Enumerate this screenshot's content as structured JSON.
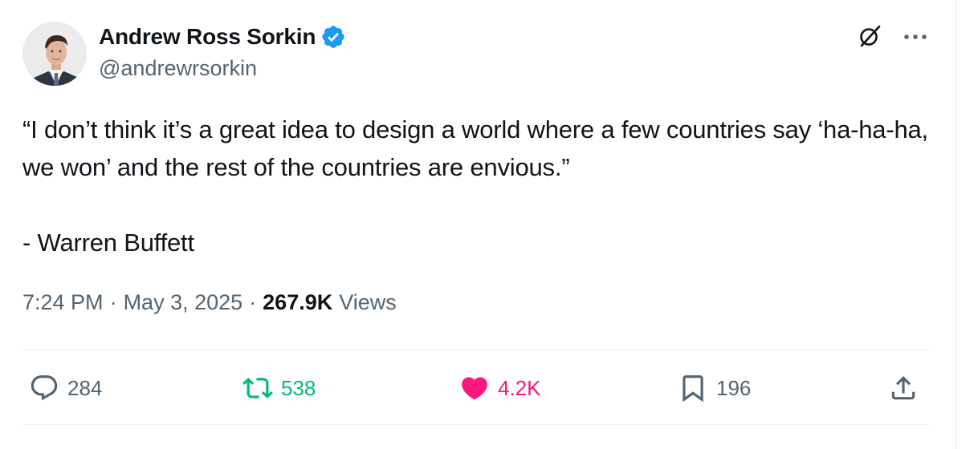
{
  "author": {
    "name": "Andrew Ross Sorkin",
    "handle": "@andrewrsorkin",
    "verified": true
  },
  "tweet": {
    "text": "“I don’t think it’s a great idea to design a world where a few countries say ‘ha-ha-ha, we won’ and the rest of the countries are envious.”\n\n- Warren Buffett"
  },
  "meta": {
    "time": "7:24 PM",
    "separator": "·",
    "date": "May 3, 2025",
    "views_count": "267.9K",
    "views_label": "Views"
  },
  "actions": {
    "replies": "284",
    "reposts": "538",
    "likes": "4.2K",
    "bookmarks": "196"
  },
  "icons": {
    "verified": "verified-badge-icon",
    "grok": "grok-icon",
    "more": "more-icon",
    "reply": "reply-icon",
    "repost": "repost-icon",
    "like": "heart-icon",
    "bookmark": "bookmark-icon",
    "share": "share-icon"
  },
  "colors": {
    "text": "#0f1419",
    "secondary": "#536471",
    "verified_blue": "#1d9bf0",
    "repost_green": "#00ba7c",
    "like_pink": "#f91880",
    "divider": "#eff3f4"
  }
}
